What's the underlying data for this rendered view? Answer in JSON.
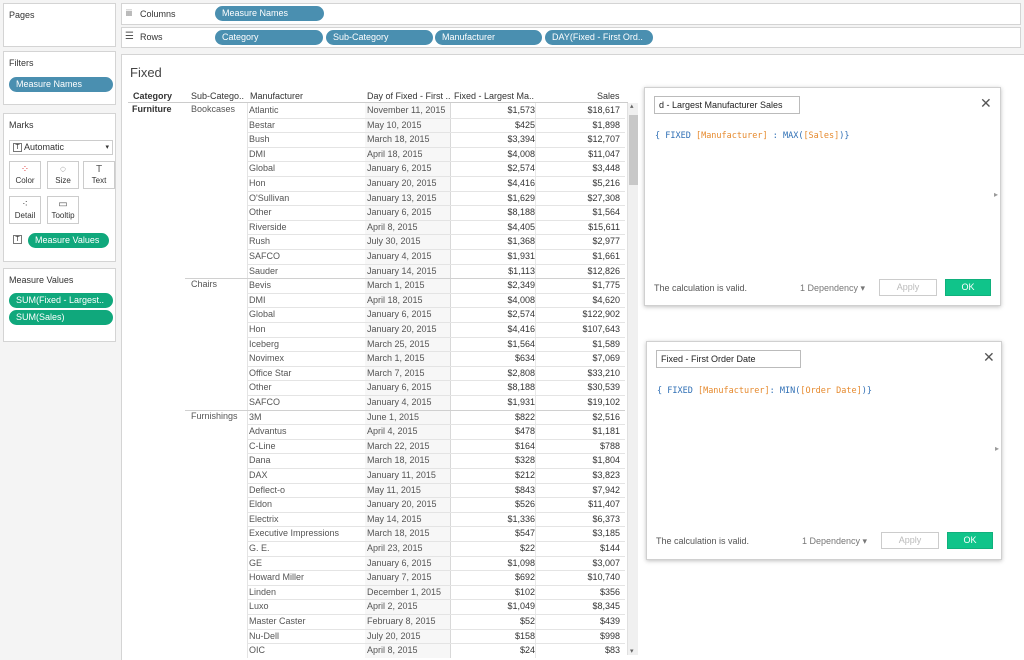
{
  "left_pane": {
    "pages_title": "Pages",
    "filters_title": "Filters",
    "filters": [
      "Measure Names"
    ],
    "marks_title": "Marks",
    "mark_type": "Automatic",
    "mark_buttons": [
      "Color",
      "Size",
      "Text",
      "Detail",
      "Tooltip"
    ],
    "marks_pill": "Measure Values",
    "measure_values_title": "Measure Values",
    "measure_values": [
      "SUM(Fixed - Largest..",
      "SUM(Sales)"
    ]
  },
  "shelves": {
    "columns_label": "Columns",
    "rows_label": "Rows",
    "columns": [
      "Measure Names"
    ],
    "rows": [
      "Category",
      "Sub-Category",
      "Manufacturer",
      "DAY(Fixed - First Ord.."
    ]
  },
  "view": {
    "title": "Fixed",
    "headers": [
      "Category",
      "Sub-Catego..",
      "Manufacturer",
      "Day of Fixed - First ..",
      "Fixed - Largest Ma..",
      "Sales"
    ],
    "category": "Furniture",
    "groups": [
      {
        "sub_category": "Bookcases",
        "rows": [
          {
            "manufacturer": "Atlantic",
            "date": "November 11, 2015",
            "largest": "$1,573",
            "sales": "$18,617"
          },
          {
            "manufacturer": "Bestar",
            "date": "May 10, 2015",
            "largest": "$425",
            "sales": "$1,898"
          },
          {
            "manufacturer": "Bush",
            "date": "March 18, 2015",
            "largest": "$3,394",
            "sales": "$12,707"
          },
          {
            "manufacturer": "DMI",
            "date": "April 18, 2015",
            "largest": "$4,008",
            "sales": "$11,047"
          },
          {
            "manufacturer": "Global",
            "date": "January 6, 2015",
            "largest": "$2,574",
            "sales": "$3,448"
          },
          {
            "manufacturer": "Hon",
            "date": "January 20, 2015",
            "largest": "$4,416",
            "sales": "$5,216"
          },
          {
            "manufacturer": "O'Sullivan",
            "date": "January 13, 2015",
            "largest": "$1,629",
            "sales": "$27,308"
          },
          {
            "manufacturer": "Other",
            "date": "January 6, 2015",
            "largest": "$8,188",
            "sales": "$1,564"
          },
          {
            "manufacturer": "Riverside",
            "date": "April 8, 2015",
            "largest": "$4,405",
            "sales": "$15,611"
          },
          {
            "manufacturer": "Rush",
            "date": "July 30, 2015",
            "largest": "$1,368",
            "sales": "$2,977"
          },
          {
            "manufacturer": "SAFCO",
            "date": "January 4, 2015",
            "largest": "$1,931",
            "sales": "$1,661"
          },
          {
            "manufacturer": "Sauder",
            "date": "January 14, 2015",
            "largest": "$1,113",
            "sales": "$12,826"
          }
        ]
      },
      {
        "sub_category": "Chairs",
        "rows": [
          {
            "manufacturer": "Bevis",
            "date": "March 1, 2015",
            "largest": "$2,349",
            "sales": "$1,775"
          },
          {
            "manufacturer": "DMI",
            "date": "April 18, 2015",
            "largest": "$4,008",
            "sales": "$4,620"
          },
          {
            "manufacturer": "Global",
            "date": "January 6, 2015",
            "largest": "$2,574",
            "sales": "$122,902"
          },
          {
            "manufacturer": "Hon",
            "date": "January 20, 2015",
            "largest": "$4,416",
            "sales": "$107,643"
          },
          {
            "manufacturer": "Iceberg",
            "date": "March 25, 2015",
            "largest": "$1,564",
            "sales": "$1,589"
          },
          {
            "manufacturer": "Novimex",
            "date": "March 1, 2015",
            "largest": "$634",
            "sales": "$7,069"
          },
          {
            "manufacturer": "Office Star",
            "date": "March 7, 2015",
            "largest": "$2,808",
            "sales": "$33,210"
          },
          {
            "manufacturer": "Other",
            "date": "January 6, 2015",
            "largest": "$8,188",
            "sales": "$30,539"
          },
          {
            "manufacturer": "SAFCO",
            "date": "January 4, 2015",
            "largest": "$1,931",
            "sales": "$19,102"
          }
        ]
      },
      {
        "sub_category": "Furnishings",
        "rows": [
          {
            "manufacturer": "3M",
            "date": "June 1, 2015",
            "largest": "$822",
            "sales": "$2,516"
          },
          {
            "manufacturer": "Advantus",
            "date": "April 4, 2015",
            "largest": "$478",
            "sales": "$1,181"
          },
          {
            "manufacturer": "C-Line",
            "date": "March 22, 2015",
            "largest": "$164",
            "sales": "$788"
          },
          {
            "manufacturer": "Dana",
            "date": "March 18, 2015",
            "largest": "$328",
            "sales": "$1,804"
          },
          {
            "manufacturer": "DAX",
            "date": "January 11, 2015",
            "largest": "$212",
            "sales": "$3,823"
          },
          {
            "manufacturer": "Deflect-o",
            "date": "May 11, 2015",
            "largest": "$843",
            "sales": "$7,942"
          },
          {
            "manufacturer": "Eldon",
            "date": "January 20, 2015",
            "largest": "$526",
            "sales": "$11,407"
          },
          {
            "manufacturer": "Electrix",
            "date": "May 14, 2015",
            "largest": "$1,336",
            "sales": "$6,373"
          },
          {
            "manufacturer": "Executive Impressions",
            "date": "March 18, 2015",
            "largest": "$547",
            "sales": "$3,185"
          },
          {
            "manufacturer": "G. E.",
            "date": "April 23, 2015",
            "largest": "$22",
            "sales": "$144"
          },
          {
            "manufacturer": "GE",
            "date": "January 6, 2015",
            "largest": "$1,098",
            "sales": "$3,007"
          },
          {
            "manufacturer": "Howard Miller",
            "date": "January 7, 2015",
            "largest": "$692",
            "sales": "$10,740"
          },
          {
            "manufacturer": "Linden",
            "date": "December 1, 2015",
            "largest": "$102",
            "sales": "$356"
          },
          {
            "manufacturer": "Luxo",
            "date": "April 2, 2015",
            "largest": "$1,049",
            "sales": "$8,345"
          },
          {
            "manufacturer": "Master Caster",
            "date": "February 8, 2015",
            "largest": "$52",
            "sales": "$439"
          },
          {
            "manufacturer": "Nu-Dell",
            "date": "July 20, 2015",
            "largest": "$158",
            "sales": "$998"
          },
          {
            "manufacturer": "OIC",
            "date": "April 8, 2015",
            "largest": "$24",
            "sales": "$83"
          }
        ]
      }
    ]
  },
  "dialog1": {
    "name": "d - Largest Manufacturer Sales",
    "formula_open": "{ FIXED ",
    "formula_field1": "[Manufacturer]",
    "formula_mid": " : MAX(",
    "formula_field2": "[Sales]",
    "formula_close": ")}",
    "valid": "The calculation is valid.",
    "dependency": "1 Dependency ▾",
    "apply": "Apply",
    "ok": "OK"
  },
  "dialog2": {
    "name": "Fixed - First Order Date",
    "formula_open": "{ FIXED ",
    "formula_field1": "[Manufacturer]",
    "formula_mid": ": MIN(",
    "formula_field2": "[Order Date]",
    "formula_close": ")}",
    "valid": "The calculation is valid.",
    "dependency": "1 Dependency ▾",
    "apply": "Apply",
    "ok": "OK"
  }
}
